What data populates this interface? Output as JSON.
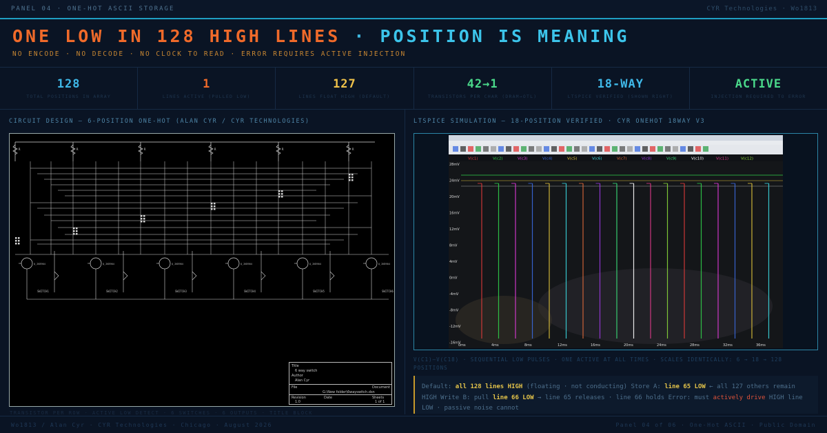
{
  "topbar": {
    "left": "PANEL 04 · ONE-HOT ASCII STORAGE",
    "right": "CYR Technologies · Wo1813"
  },
  "headline": {
    "part1": "ONE LOW IN 128 HIGH LINES",
    "sep": " · ",
    "part2": "POSITION IS MEANING"
  },
  "subline": "NO ENCODE · NO DECODE · NO CLOCK TO READ · ERROR REQUIRES ACTIVE INJECTION",
  "stats": [
    {
      "value": "128",
      "label": "TOTAL POSITIONS IN ARRAY",
      "color": "#3fb8e8"
    },
    {
      "value": "1",
      "label": "LINES ACTIVE (PULLED LOW)",
      "color": "#f06a2a"
    },
    {
      "value": "127",
      "label": "LINES FLOAT HIGH (DEFAULT)",
      "color": "#f0c24a"
    },
    {
      "value": "42→1",
      "label": "TRANSISTORS PER CHAR (DRAM→OTL)",
      "color": "#4ad88a"
    },
    {
      "value": "18-WAY",
      "label": "LTSPICE VERIFIED (SHOWN RIGHT)",
      "color": "#3fb8e8"
    },
    {
      "value": "ACTIVE",
      "label": "INJECTION REQUIRED TO ERROR",
      "color": "#4ad88a"
    }
  ],
  "left_panel": {
    "title": "CIRCUIT DESIGN — 6-POSITION ONE-HOT (ALAN CYR / CYR TECHNOLOGIES)",
    "title_block": {
      "title_label": "Title",
      "title_value": "6 way switch",
      "author_label": "Author",
      "author_value": "Alan Cyr",
      "file_label": "File",
      "file_value": "G:\\New folder\\6wayswitch.dsn",
      "document_label": "Document",
      "revision_label": "Revision",
      "revision_value": "1.0",
      "date_label": "Date",
      "sheets_label": "Sheets",
      "sheets_value": "1 of 1"
    },
    "switch_labels": [
      "SWITCH1",
      "SWITCH2",
      "SWITCH3",
      "SWITCH4",
      "SWITCH5",
      "SWITCH6"
    ],
    "transistor_label": "Q_2N3904",
    "resistor_label": "R"
  },
  "right_panel": {
    "title": "LTSPICE SIMULATION — 18-POSITION VERIFIED · CYR ONEHOT 18WAY V3",
    "caption": "V(C1)–V(C18) · SEQUENTIAL LOW PULSES · ONE ACTIVE AT ALL TIMES · SCALES IDENTICALLY: 6 → 18 → 128 POSITIONS",
    "y_ticks": [
      "28mV",
      "24mV",
      "20mV",
      "16mV",
      "12mV",
      "8mV",
      "4mV",
      "0mV",
      "-4mV",
      "-8mV",
      "-12mV",
      "-16mV"
    ],
    "x_ticks": [
      "0ms",
      "4ms",
      "8ms",
      "12ms",
      "16ms",
      "20ms",
      "24ms",
      "28ms",
      "32ms",
      "36ms"
    ],
    "trace_labels": [
      "V(c1)",
      "V(c2)",
      "V(c3)",
      "V(c4)",
      "V(c5)",
      "V(c6)",
      "V(c7)",
      "V(c8)",
      "V(c9)",
      "V(c10)",
      "V(c11)",
      "V(c12)"
    ],
    "colors": [
      "#e03a3a",
      "#2fd04a",
      "#e03ad8",
      "#3a6ae0",
      "#e0c23a",
      "#3ad8e0",
      "#e06a3a",
      "#9a3ae0",
      "#3ae07a",
      "#ffffff",
      "#e03a8a",
      "#8ad83a"
    ]
  },
  "notes": {
    "l1a": "Default: ",
    "l1b": "all 128 lines HIGH",
    "l1c": " (floating · not conducting) Store A: ",
    "l1d": "line 65 LOW",
    "l1e": " ← all 127 others remain",
    "l2a": "HIGH Write B: pull ",
    "l2b": "line 66 LOW",
    "l2c": " → line 65 releases · line 66 holds Error: must ",
    "l2d": "actively drive",
    "l2e": " HIGH line",
    "l3": "LOW · passive noise cannot"
  },
  "ghost_text": "TRANSISTOR PER ROW · ACTIVE LOW DETECT · 6 SWITCHES · 6 OUTPUTS · TITLE BLOCK",
  "footer": {
    "left": "Wo1813 / Alan Cyr · CYR Technologies · Chicago · August 2026",
    "right": "Panel 04 of 06 · One-Hot ASCII · Public Domain"
  }
}
